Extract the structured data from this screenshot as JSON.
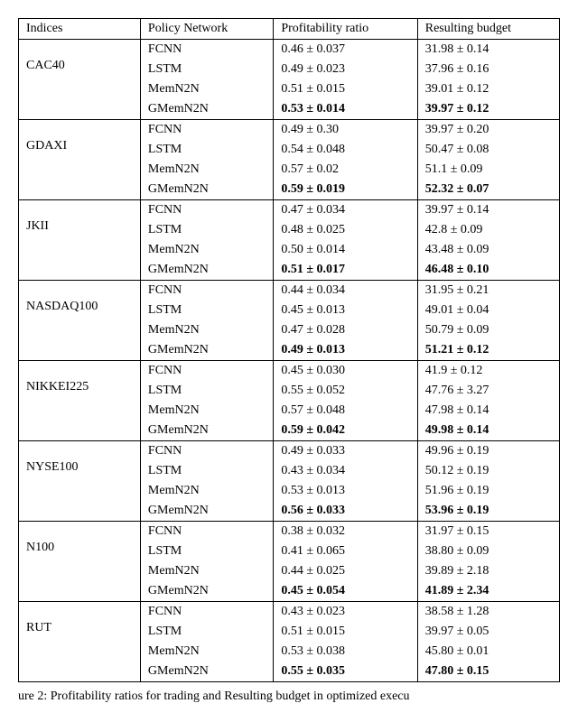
{
  "headers": {
    "indices": "Indices",
    "policy": "Policy Network",
    "profit": "Profitability ratio",
    "budget": "Resulting budget"
  },
  "caption": "ure 2: Profitability ratios for trading and Resulting budget in optimized execu",
  "groups": [
    {
      "index": "CAC40",
      "rows": [
        {
          "policy": "FCNN",
          "profit": "0.46 ± 0.037",
          "budget": "31.98 ± 0.14",
          "bold": false
        },
        {
          "policy": "LSTM",
          "profit": "0.49 ± 0.023",
          "budget": "37.96 ± 0.16",
          "bold": false
        },
        {
          "policy": "MemN2N",
          "profit": "0.51 ± 0.015",
          "budget": "39.01 ± 0.12",
          "bold": false
        },
        {
          "policy": "GMemN2N",
          "profit": "0.53 ± 0.014",
          "budget": "39.97 ± 0.12",
          "bold": true
        }
      ]
    },
    {
      "index": "GDAXI",
      "rows": [
        {
          "policy": "FCNN",
          "profit": "0.49 ± 0.30",
          "budget": "39.97 ± 0.20",
          "bold": false
        },
        {
          "policy": "LSTM",
          "profit": "0.54 ± 0.048",
          "budget": "50.47 ± 0.08",
          "bold": false
        },
        {
          "policy": "MemN2N",
          "profit": "0.57 ± 0.02",
          "budget": "51.1 ± 0.09",
          "bold": false
        },
        {
          "policy": "GMemN2N",
          "profit": "0.59 ± 0.019",
          "budget": "52.32 ± 0.07",
          "bold": true
        }
      ]
    },
    {
      "index": "JKII",
      "rows": [
        {
          "policy": "FCNN",
          "profit": "0.47 ± 0.034",
          "budget": "39.97 ± 0.14",
          "bold": false
        },
        {
          "policy": "LSTM",
          "profit": "0.48 ± 0.025",
          "budget": "42.8 ± 0.09",
          "bold": false
        },
        {
          "policy": "MemN2N",
          "profit": "0.50 ± 0.014",
          "budget": "43.48 ± 0.09",
          "bold": false
        },
        {
          "policy": "GMemN2N",
          "profit": "0.51 ± 0.017",
          "budget": "46.48 ± 0.10",
          "bold": true
        }
      ]
    },
    {
      "index": "NASDAQ100",
      "rows": [
        {
          "policy": "FCNN",
          "profit": "0.44 ± 0.034",
          "budget": "31.95 ± 0.21",
          "bold": false
        },
        {
          "policy": "LSTM",
          "profit": "0.45 ± 0.013",
          "budget": "49.01 ± 0.04",
          "bold": false
        },
        {
          "policy": "MemN2N",
          "profit": "0.47 ± 0.028",
          "budget": "50.79 ± 0.09",
          "bold": false
        },
        {
          "policy": "GMemN2N",
          "profit": "0.49 ± 0.013",
          "budget": "51.21 ± 0.12",
          "bold": true
        }
      ]
    },
    {
      "index": "NIKKEI225",
      "rows": [
        {
          "policy": "FCNN",
          "profit": "0.45 ± 0.030",
          "budget": "41.9 ± 0.12",
          "bold": false
        },
        {
          "policy": "LSTM",
          "profit": "0.55 ± 0.052",
          "budget": "47.76 ± 3.27",
          "bold": false
        },
        {
          "policy": "MemN2N",
          "profit": "0.57 ± 0.048",
          "budget": "47.98 ± 0.14",
          "bold": false
        },
        {
          "policy": "GMemN2N",
          "profit": "0.59 ± 0.042",
          "budget": "49.98 ± 0.14",
          "bold": true
        }
      ]
    },
    {
      "index": "NYSE100",
      "rows": [
        {
          "policy": "FCNN",
          "profit": "0.49 ± 0.033",
          "budget": "49.96 ± 0.19",
          "bold": false
        },
        {
          "policy": "LSTM",
          "profit": "0.43 ± 0.034",
          "budget": "50.12 ± 0.19",
          "bold": false
        },
        {
          "policy": "MemN2N",
          "profit": "0.53 ± 0.013",
          "budget": "51.96 ± 0.19",
          "bold": false
        },
        {
          "policy": "GMemN2N",
          "profit": "0.56 ± 0.033",
          "budget": "53.96 ± 0.19",
          "bold": true
        }
      ]
    },
    {
      "index": "N100",
      "rows": [
        {
          "policy": "FCNN",
          "profit": "0.38 ± 0.032",
          "budget": "31.97 ± 0.15",
          "bold": false
        },
        {
          "policy": "LSTM",
          "profit": "0.41 ± 0.065",
          "budget": "38.80 ± 0.09",
          "bold": false
        },
        {
          "policy": "MemN2N",
          "profit": "0.44 ± 0.025",
          "budget": "39.89 ± 2.18",
          "bold": false
        },
        {
          "policy": "GMemN2N",
          "profit": "0.45 ± 0.054",
          "budget": "41.89 ± 2.34",
          "bold": true
        }
      ]
    },
    {
      "index": "RUT",
      "rows": [
        {
          "policy": "FCNN",
          "profit": "0.43 ± 0.023",
          "budget": "38.58 ± 1.28",
          "bold": false
        },
        {
          "policy": "LSTM",
          "profit": "0.51 ± 0.015",
          "budget": "39.97 ± 0.05",
          "bold": false
        },
        {
          "policy": "MemN2N",
          "profit": "0.53 ± 0.038",
          "budget": "45.80 ± 0.01",
          "bold": false
        },
        {
          "policy": "GMemN2N",
          "profit": "0.55 ± 0.035",
          "budget": "47.80 ± 0.15",
          "bold": true
        }
      ]
    }
  ]
}
